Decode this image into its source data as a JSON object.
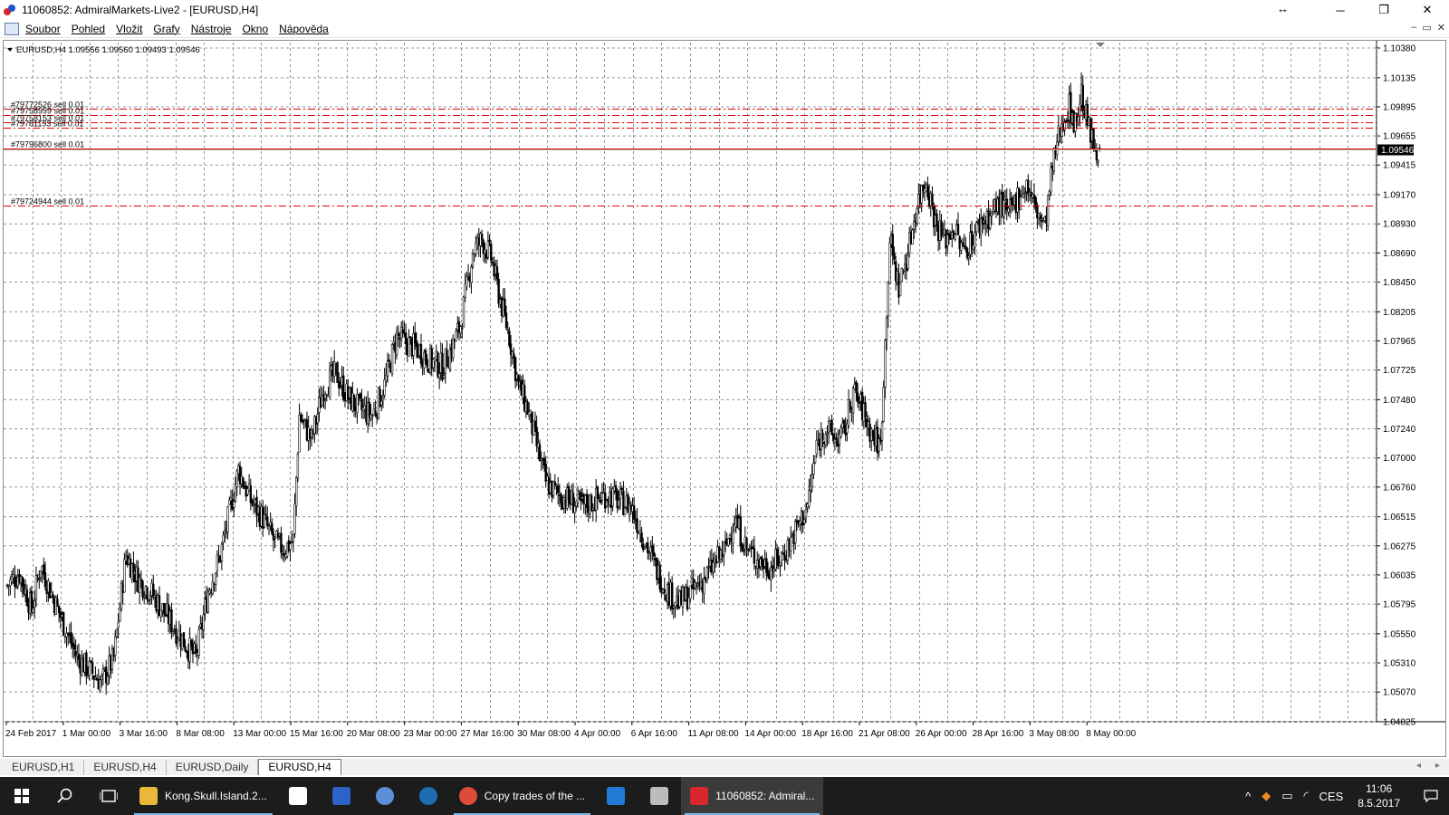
{
  "window": {
    "title": "11060852: AdmiralMarkets-Live2 - [EURUSD,H4]",
    "controls": [
      "─",
      "❐",
      "✕"
    ],
    "resize_symbol": "↔"
  },
  "menu": {
    "items": [
      "Soubor",
      "Pohled",
      "Vložit",
      "Grafy",
      "Nástroje",
      "Okno",
      "Nápověda"
    ],
    "mdi_controls": [
      "–",
      "▭",
      "✕"
    ]
  },
  "chart": {
    "header": "EURUSD,H4  1.09556 1.09560 1.09493 1.09546",
    "current_price": "1.09546",
    "colors": {
      "grid": "#8c9aa8",
      "candle": "#000000",
      "order_line": "#e00000",
      "price_tag_bg": "#000000",
      "price_tag_fg": "#ffffff"
    }
  },
  "chart_data": {
    "type": "candlestick",
    "symbol": "EURUSD",
    "timeframe": "H4",
    "ohlc_header": {
      "open": 1.09556,
      "high": 1.0956,
      "low": 1.09493,
      "close": 1.09546
    },
    "price_ticks": [
      "1.10380",
      "1.10135",
      "1.09895",
      "1.09655",
      "1.09415",
      "1.09170",
      "1.08930",
      "1.08690",
      "1.08450",
      "1.08205",
      "1.07965",
      "1.07725",
      "1.07480",
      "1.07240",
      "1.07000",
      "1.06760",
      "1.06515",
      "1.06275",
      "1.06035",
      "1.05795",
      "1.05550",
      "1.05310",
      "1.05070",
      "1.04825"
    ],
    "time_ticks": [
      "24 Feb 2017",
      "1 Mar 00:00",
      "3 Mar 16:00",
      "8 Mar 08:00",
      "13 Mar 00:00",
      "15 Mar 16:00",
      "20 Mar 08:00",
      "23 Mar 00:00",
      "27 Mar 16:00",
      "30 Mar 08:00",
      "4 Apr 00:00",
      "6 Apr 16:00",
      "11 Apr 08:00",
      "14 Apr 00:00",
      "18 Apr 16:00",
      "21 Apr 08:00",
      "26 Apr 00:00",
      "28 Apr 16:00",
      "3 May 08:00",
      "8 May 00:00"
    ],
    "ylim": [
      1.04825,
      1.1038
    ],
    "path_keypoints": [
      [
        0,
        1.0595
      ],
      [
        8,
        1.0605
      ],
      [
        16,
        1.0575
      ],
      [
        22,
        1.0612
      ],
      [
        30,
        1.0585
      ],
      [
        38,
        1.056
      ],
      [
        46,
        1.0535
      ],
      [
        54,
        1.0525
      ],
      [
        62,
        1.0515
      ],
      [
        70,
        1.0535
      ],
      [
        78,
        1.062
      ],
      [
        86,
        1.06
      ],
      [
        94,
        1.059
      ],
      [
        102,
        1.0575
      ],
      [
        110,
        1.056
      ],
      [
        118,
        1.0545
      ],
      [
        124,
        1.0535
      ],
      [
        132,
        1.059
      ],
      [
        140,
        1.062
      ],
      [
        146,
        1.0655
      ],
      [
        152,
        1.069
      ],
      [
        160,
        1.0665
      ],
      [
        168,
        1.065
      ],
      [
        176,
        1.063
      ],
      [
        182,
        1.0625
      ],
      [
        188,
        1.0632
      ],
      [
        192,
        1.0735
      ],
      [
        200,
        1.0715
      ],
      [
        208,
        1.0758
      ],
      [
        216,
        1.077
      ],
      [
        224,
        1.075
      ],
      [
        232,
        1.074
      ],
      [
        240,
        1.0735
      ],
      [
        248,
        1.076
      ],
      [
        256,
        1.08
      ],
      [
        262,
        1.0795
      ],
      [
        270,
        1.079
      ],
      [
        278,
        1.078
      ],
      [
        286,
        1.0775
      ],
      [
        292,
        1.079
      ],
      [
        298,
        1.081
      ],
      [
        306,
        1.087
      ],
      [
        312,
        1.088
      ],
      [
        318,
        1.0865
      ],
      [
        324,
        1.083
      ],
      [
        330,
        1.08
      ],
      [
        336,
        1.076
      ],
      [
        342,
        1.074
      ],
      [
        348,
        1.071
      ],
      [
        354,
        1.068
      ],
      [
        362,
        1.067
      ],
      [
        370,
        1.0665
      ],
      [
        378,
        1.066
      ],
      [
        386,
        1.0665
      ],
      [
        394,
        1.067
      ],
      [
        402,
        1.0665
      ],
      [
        410,
        1.066
      ],
      [
        418,
        1.0635
      ],
      [
        426,
        1.061
      ],
      [
        434,
        1.059
      ],
      [
        442,
        1.058
      ],
      [
        450,
        1.059
      ],
      [
        458,
        1.06
      ],
      [
        466,
        1.0615
      ],
      [
        472,
        1.0625
      ],
      [
        478,
        1.065
      ],
      [
        486,
        1.0625
      ],
      [
        494,
        1.0615
      ],
      [
        502,
        1.061
      ],
      [
        510,
        1.062
      ],
      [
        518,
        1.064
      ],
      [
        526,
        1.066
      ],
      [
        532,
        1.071
      ],
      [
        538,
        1.0725
      ],
      [
        544,
        1.0715
      ],
      [
        550,
        1.072
      ],
      [
        556,
        1.0755
      ],
      [
        562,
        1.074
      ],
      [
        568,
        1.072
      ],
      [
        574,
        1.071
      ],
      [
        580,
        1.088
      ],
      [
        586,
        1.084
      ],
      [
        592,
        1.087
      ],
      [
        598,
        1.091
      ],
      [
        604,
        1.093
      ],
      [
        610,
        1.0895
      ],
      [
        616,
        1.088
      ],
      [
        622,
        1.089
      ],
      [
        628,
        1.087
      ],
      [
        634,
        1.088
      ],
      [
        640,
        1.0895
      ],
      [
        646,
        1.09
      ],
      [
        652,
        1.091
      ],
      [
        658,
        1.09
      ],
      [
        664,
        1.0915
      ],
      [
        670,
        1.0925
      ],
      [
        676,
        1.0905
      ],
      [
        682,
        1.089
      ],
      [
        686,
        1.093
      ],
      [
        690,
        1.096
      ],
      [
        694,
        1.098
      ],
      [
        698,
        1.099
      ],
      [
        702,
        1.0975
      ],
      [
        706,
        1.1
      ],
      [
        710,
        1.0975
      ],
      [
        714,
        1.0958
      ],
      [
        718,
        1.09546
      ]
    ],
    "orders": [
      {
        "label": "#79772526 sell 0.01",
        "price": 1.0988,
        "style": "dash"
      },
      {
        "label": "#79758999 sell 0.01",
        "price": 1.0983,
        "style": "dash"
      },
      {
        "label": "#79758153 sell 0.01",
        "price": 1.0977,
        "style": "dash"
      },
      {
        "label": "#79781193 sell 0.01",
        "price": 1.0972,
        "style": "dash"
      },
      {
        "label": "#79796800 sell 0.01",
        "price": 1.0955,
        "style": "solid"
      },
      {
        "label": "#79724944 sell 0.01",
        "price": 1.0908,
        "style": "dash"
      }
    ]
  },
  "tabs": [
    {
      "label": "EURUSD,H1",
      "active": false
    },
    {
      "label": "EURUSD,H4",
      "active": false
    },
    {
      "label": "EURUSD,Daily",
      "active": false
    },
    {
      "label": "EURUSD,H4",
      "active": true
    }
  ],
  "tab_scroll": [
    "◂",
    "▸"
  ],
  "taskbar": {
    "start_icon": "windows-logo-icon",
    "search_icon": "search-icon",
    "task_view_icon": "task-view-icon",
    "apps": [
      {
        "label": "Kong.Skull.Island.2...",
        "icon": "folder-icon",
        "color": "#e8b83a",
        "open": true,
        "active": false
      },
      {
        "label": "",
        "icon": "store-icon",
        "color": "#ffffff",
        "open": false,
        "active": false
      },
      {
        "label": "",
        "icon": "photoshop-icon",
        "color": "#2a64c8",
        "open": false,
        "active": false
      },
      {
        "label": "",
        "icon": "browser-globe-icon",
        "color": "#5b8fd6",
        "open": false,
        "active": false
      },
      {
        "label": "",
        "icon": "media-player-icon",
        "color": "#1e6db0",
        "open": false,
        "active": false
      },
      {
        "label": "Copy trades of the ...",
        "icon": "chrome-icon",
        "color": "#dd4b39",
        "open": true,
        "active": false
      },
      {
        "label": "",
        "icon": "edge-icon",
        "color": "#1f7bd6",
        "open": false,
        "active": false
      },
      {
        "label": "",
        "icon": "printer-icon",
        "color": "#bcbcbc",
        "open": false,
        "active": false
      },
      {
        "label": "11060852: Admiral...",
        "icon": "metatrader-icon",
        "color": "#d8262c",
        "open": true,
        "active": true
      }
    ],
    "tray": {
      "language": "CES",
      "time": "11:06",
      "date": "8.5.2017"
    }
  }
}
